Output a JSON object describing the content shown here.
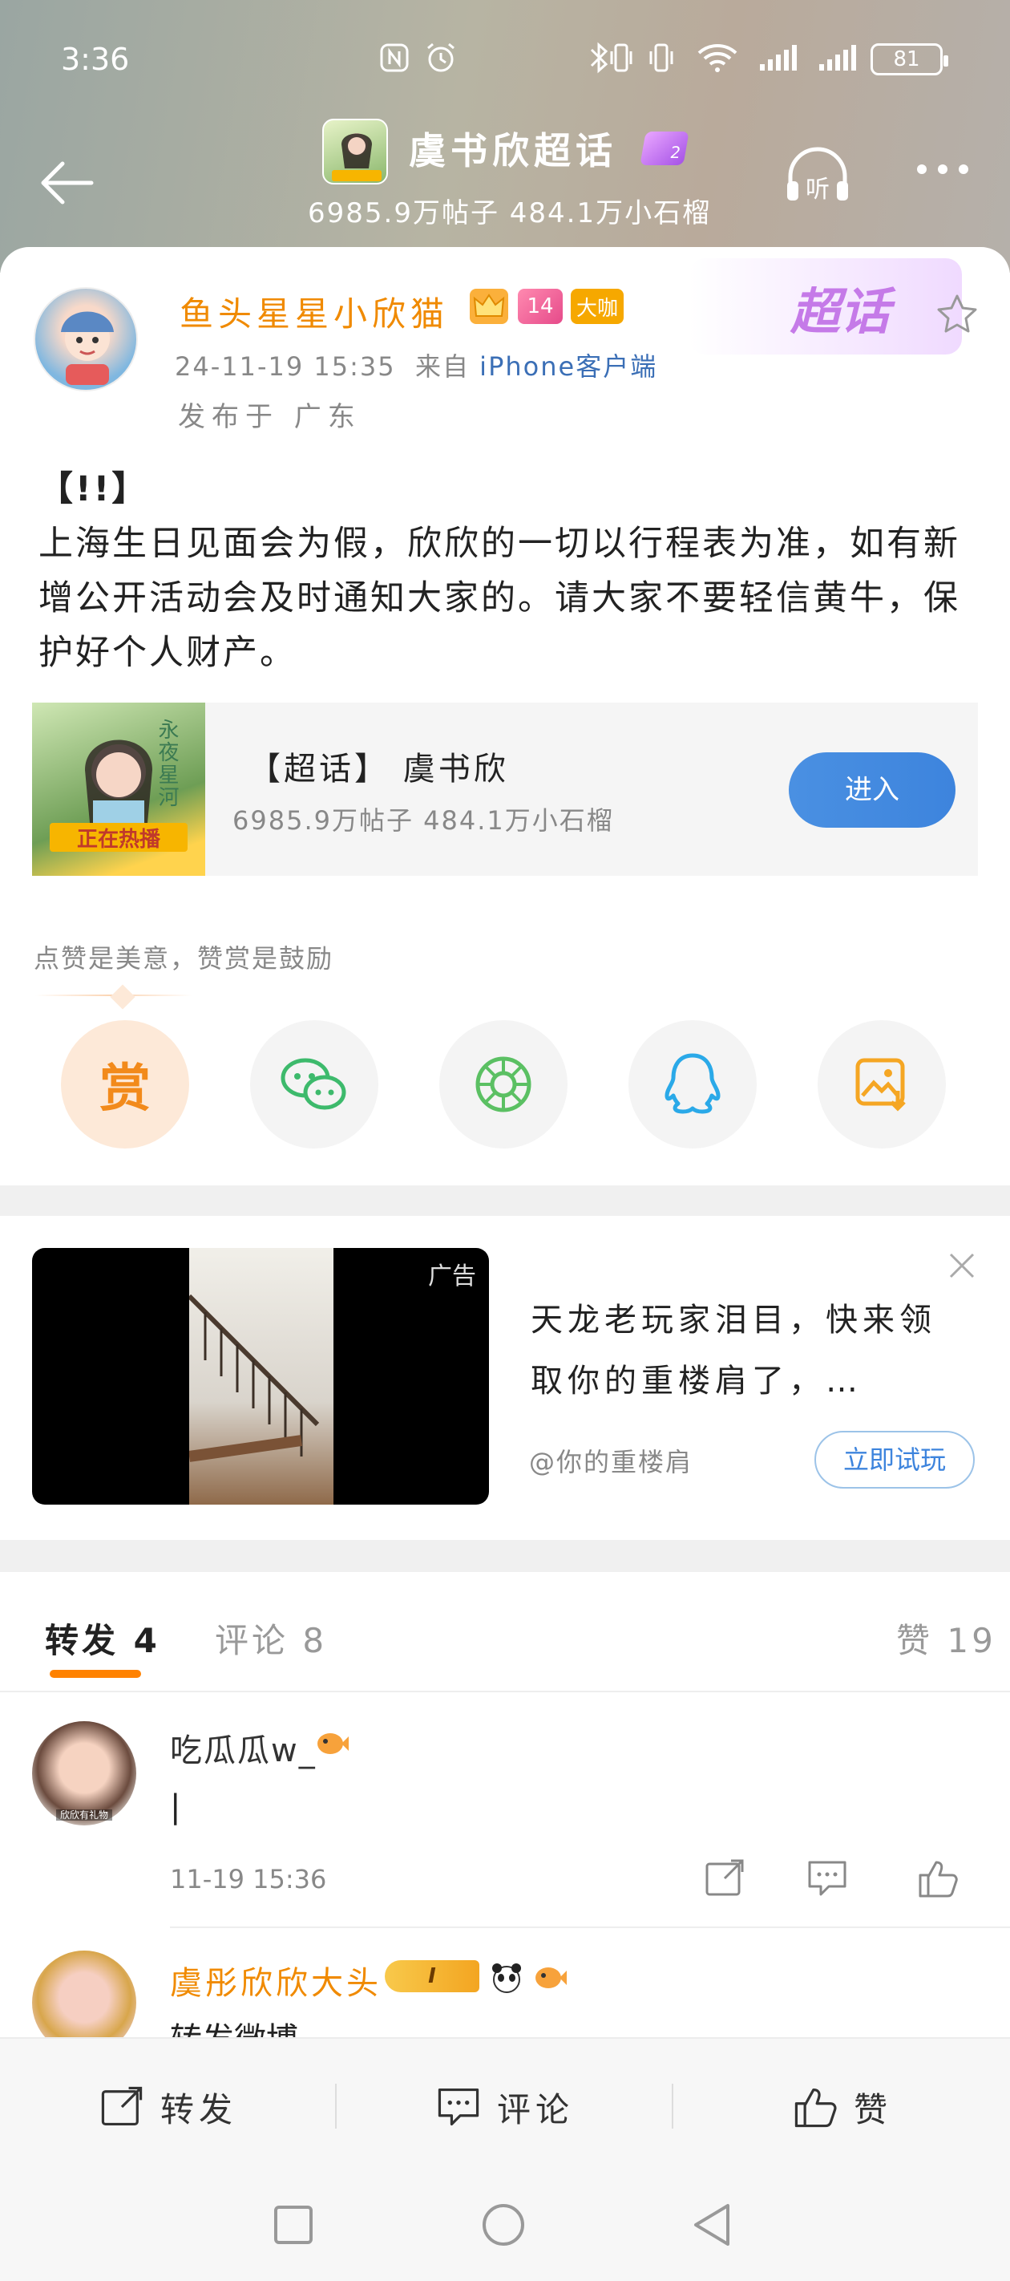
{
  "status_bar": {
    "time": "3:36",
    "battery": "81"
  },
  "header": {
    "title": "虞书欣超话",
    "level_badge": "2",
    "stats": "6985.9万帖子  484.1万小石榴",
    "listen_label": "听"
  },
  "post": {
    "author": "鱼头星星小欣猫",
    "vip_level": "14",
    "big_v_badge": "大咖",
    "timestamp": "24-11-19 15:35",
    "from_label": "来自",
    "source": "iPhone客户端",
    "location": "发布于 广东",
    "chaohua_label": "超话",
    "text_line1": "【!!】",
    "text_body": "上海生日见面会为假，欣欣的一切以行程表为准，如有新增公开活动会及时通知大家的。请大家不要轻信黄牛，保护好个人财产。"
  },
  "topic_card": {
    "title": "【超话】 虞书欣",
    "stats": "6985.9万帖子  484.1万小石榴",
    "enter_label": "进入",
    "image_banner": "正在热播",
    "image_caption": "永夜星河"
  },
  "reward": {
    "hint": "点赞是美意，赞赏是鼓励",
    "reward_label": "赏"
  },
  "share_icons": [
    "reward-icon",
    "wechat-icon",
    "moments-icon",
    "qq-icon",
    "save-image-icon"
  ],
  "ad": {
    "tag": "广告",
    "text": "天龙老玩家泪目，快来领取你的重楼肩了，…",
    "account": "@你的重楼肩",
    "cta": "立即试玩"
  },
  "tabs": {
    "repost": "转发 4",
    "comment": "评论 8",
    "like": "赞 19"
  },
  "comments": [
    {
      "name": "吃瓜瓜w_",
      "text": "|",
      "time": "11-19 15:36",
      "avatar_caption": "欣欣有礼物"
    },
    {
      "name": "虞彤欣欣大头",
      "text": "转发微博",
      "rank": "I"
    }
  ],
  "bottom_bar": {
    "repost": "转发",
    "comment": "评论",
    "like": "赞"
  },
  "colors": {
    "accent_orange": "#ff8200",
    "link_blue": "#3b6fb6",
    "button_blue": "#3d84dd"
  }
}
